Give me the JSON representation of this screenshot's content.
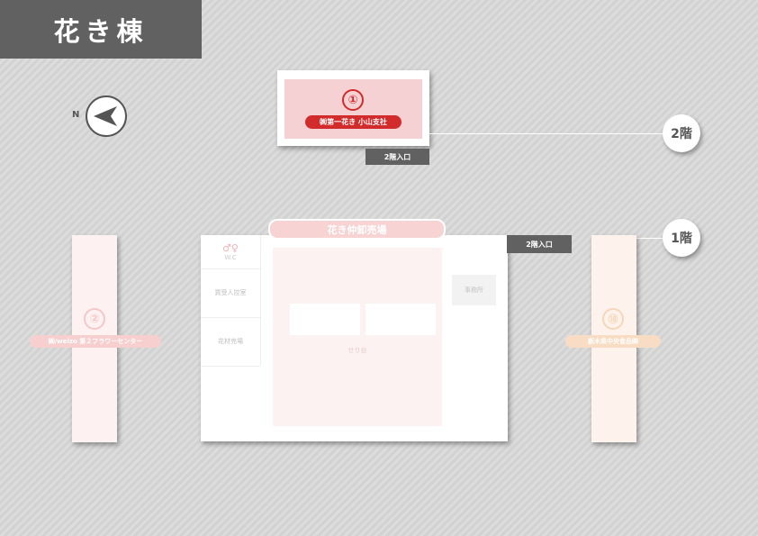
{
  "header": {
    "title": "花き棟"
  },
  "compass": {
    "label": "N",
    "icon": "north-arrow-icon"
  },
  "floors": {
    "second": "2階",
    "first": "1階"
  },
  "entrances": {
    "upper": "2階入口",
    "main": "2階入口"
  },
  "buildings": {
    "upper": {
      "number": "①",
      "tenant": "㈱第一花き 小山支社"
    },
    "left": {
      "number": "②",
      "tenant": "㈱/welzo 第２フラワーセンター"
    },
    "right": {
      "number": "⑱",
      "tenant": "栃木県中央食品㈱"
    },
    "main": {
      "callout": "花き仲卸売場",
      "wc_label": "W.C",
      "buyer_room": "買受人控室",
      "flower_market": "花材売場",
      "auction": "せり台",
      "office": "事務所"
    }
  },
  "colors": {
    "accent_red": "#d12b2b",
    "header_bg": "#616161",
    "pink": "#f5d1d3"
  }
}
